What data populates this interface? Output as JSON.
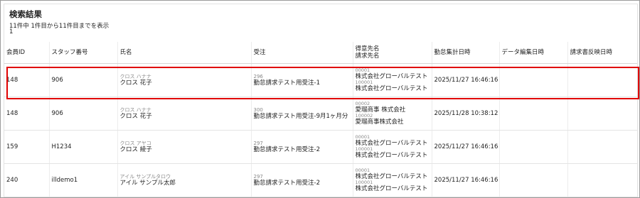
{
  "header": {
    "title": "検索結果",
    "count_text": "11件中 1件目から11件目までを表示",
    "page": "1"
  },
  "columns": [
    "会員ID",
    "スタッフ番号",
    "氏名",
    "受注",
    [
      "得意先名",
      "請求先名"
    ],
    "勤怠集計日時",
    "データ編集日時",
    "請求書反映日時"
  ],
  "rows": [
    {
      "member_id": "148",
      "staff_no": "906",
      "name_kana": "クロス ハナナ",
      "name": "クロス 花子",
      "order_no": "296",
      "order_name": "勤怠請求テスト用受注-1",
      "client_code": "00001",
      "client_name": "株式会社グローバルテスト",
      "billing_code": "100001",
      "billing_name": "株式会社グローバルテスト",
      "attendance_at": "2025/11/27 16:46:16",
      "edited_at": "",
      "invoice_at": ""
    },
    {
      "member_id": "148",
      "staff_no": "906",
      "name_kana": "クロス ハナナ",
      "name": "クロス 花子",
      "order_no": "300",
      "order_name": "勤怠請求テスト用受注-9月1ヶ月分",
      "client_code": "00002",
      "client_name": "愛瑠商事 株式会社",
      "billing_code": "100002",
      "billing_name": "愛瑠商事株式会社",
      "attendance_at": "2025/11/28 10:38:12",
      "edited_at": "",
      "invoice_at": ""
    },
    {
      "member_id": "159",
      "staff_no": "H1234",
      "name_kana": "クロス アヤコ",
      "name": "クロス 綾子",
      "order_no": "297",
      "order_name": "勤怠請求テスト用受注-2",
      "client_code": "00001",
      "client_name": "株式会社グローバルテスト",
      "billing_code": "100001",
      "billing_name": "株式会社グローバルテスト",
      "attendance_at": "2025/11/27 16:46:16",
      "edited_at": "",
      "invoice_at": ""
    },
    {
      "member_id": "240",
      "staff_no": "illdemo1",
      "name_kana": "アイル サンプルタロウ",
      "name": "アイル サンプル太郎",
      "order_no": "297",
      "order_name": "勤怠請求テスト用受注-2",
      "client_code": "00001",
      "client_name": "株式会社グローバルテスト",
      "billing_code": "100001",
      "billing_name": "株式会社グローバルテスト",
      "attendance_at": "2025/11/27 16:46:16",
      "edited_at": "",
      "invoice_at": ""
    }
  ],
  "highlight_color": "#e00000"
}
